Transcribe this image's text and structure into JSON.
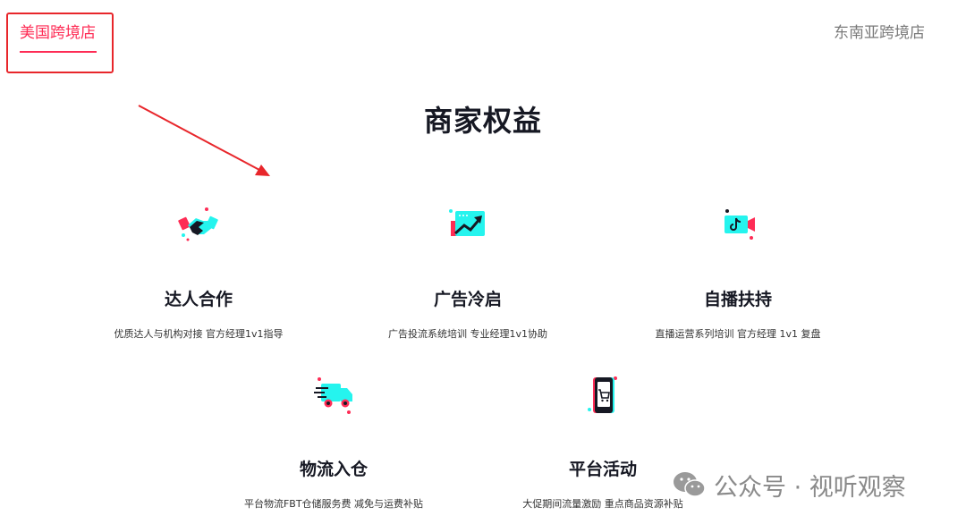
{
  "tabs": {
    "us": "美国跨境店",
    "sea": "东南亚跨境店"
  },
  "section": {
    "title": "商家权益"
  },
  "benefits": [
    {
      "title": "达人合作",
      "desc": "优质达人与机构对接 官方经理1v1指导",
      "icon": "handshake-icon"
    },
    {
      "title": "广告冷启",
      "desc": "广告投流系统培训 专业经理1v1协助",
      "icon": "trend-chart-icon"
    },
    {
      "title": "自播扶持",
      "desc": "直播运营系列培训 官方经理 1v1 复盘",
      "icon": "video-camera-icon"
    },
    {
      "title": "物流入仓",
      "desc": "平台物流FBT仓储服务费 减免与运费补贴",
      "icon": "delivery-truck-icon"
    },
    {
      "title": "平台活动",
      "desc": "大促期间流量激励 重点商品资源补贴",
      "icon": "phone-cart-icon"
    }
  ],
  "watermark": {
    "text": "公众号 · 视听观察",
    "icon": "wechat-icon"
  },
  "colors": {
    "accent": "#fe2c55",
    "cyan": "#25f4ee",
    "dark": "#161823",
    "annotation": "#e8262b"
  }
}
